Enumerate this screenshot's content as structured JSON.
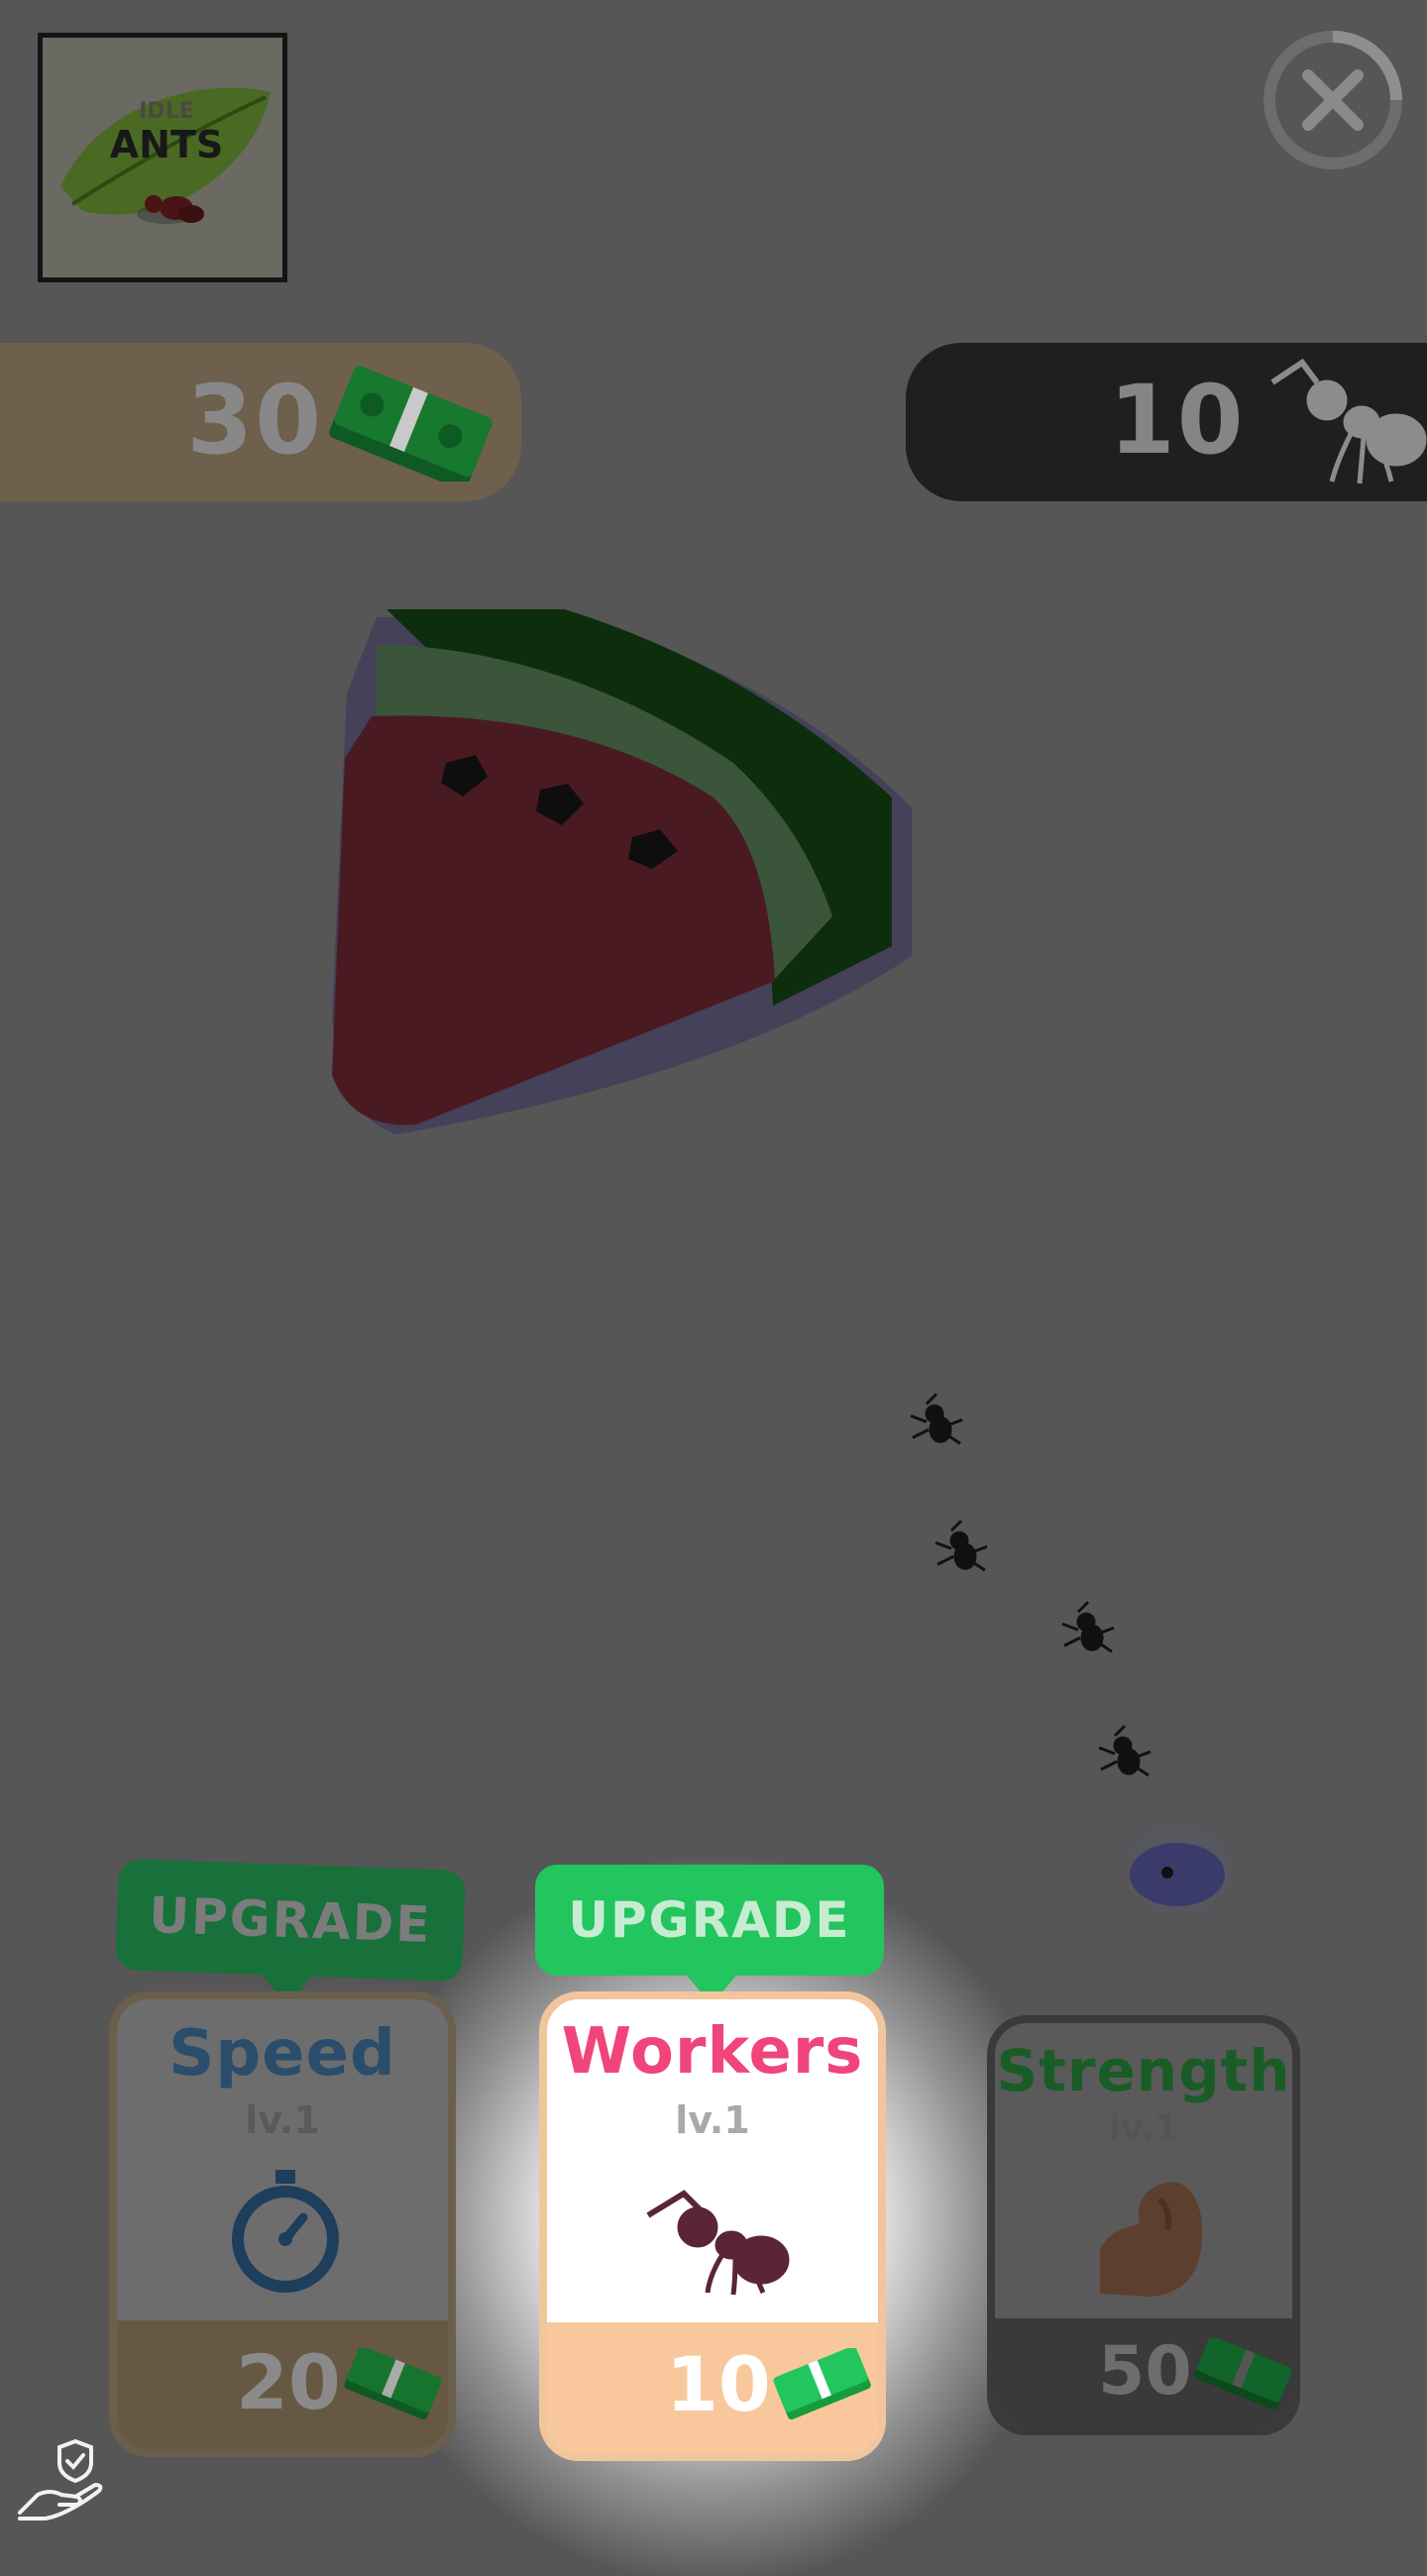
{
  "logo": {
    "line1": "IDLE",
    "line2": "ANTS"
  },
  "close": {
    "icon": "close-icon"
  },
  "resources": {
    "money": {
      "value": "30",
      "icon": "cash-icon"
    },
    "ants": {
      "value": "10",
      "icon": "ant-icon"
    }
  },
  "upgrades": [
    {
      "badge": "UPGRADE",
      "title": "Speed",
      "level": "lv.1",
      "icon": "stopwatch-icon",
      "price": "20",
      "price_icon": "cash-icon",
      "title_color": "#2a4d6c"
    },
    {
      "badge": "UPGRADE",
      "title": "Workers",
      "level": "lv.1",
      "icon": "ant-icon",
      "price": "10",
      "price_icon": "cash-icon",
      "title_color": "#f0457a"
    },
    {
      "title": "Strength",
      "level": "lv.1",
      "icon": "muscle-arm-icon",
      "price": "50",
      "price_icon": "cash-icon",
      "title_color": "#1a5c26"
    }
  ],
  "colors": {
    "background": "#565656",
    "accent_green": "#22c55e",
    "workers_title": "#f0457a",
    "price_panel": "#f8c89c"
  },
  "footer": {
    "icon": "privacy-shield-hand-icon"
  }
}
